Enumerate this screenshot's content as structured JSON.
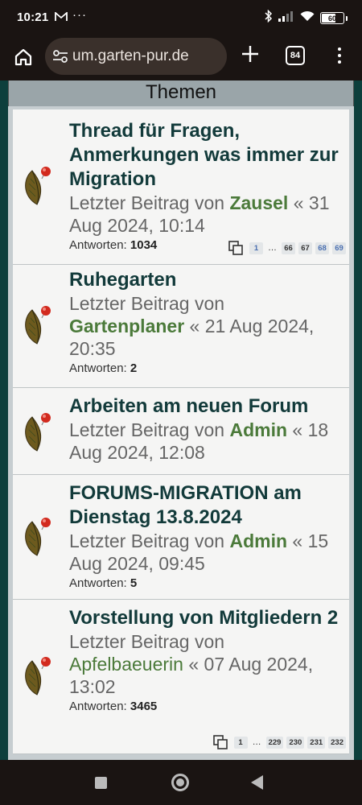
{
  "status_bar": {
    "time": "10:21",
    "dots": "···",
    "battery": "60",
    "icons": [
      "gmail-icon",
      "bluetooth-icon",
      "signal-icon",
      "wifi-icon",
      "battery-icon"
    ]
  },
  "browser": {
    "url": "um.garten-pur.de",
    "tab_count": "84",
    "icons": [
      "home-icon",
      "site-settings-icon",
      "new-tab-icon",
      "tabs-icon",
      "menu-icon"
    ]
  },
  "section_title": "Themen",
  "topics": [
    {
      "title": "Thread für Fragen, Anmerkungen was immer zur Migration",
      "last_prefix": "Letzter Beitrag von",
      "author": "Zausel",
      "date": "« 31 Aug 2024, 10:14",
      "replies_label": "Antworten:",
      "replies": "1034",
      "pages": [
        "1",
        "…",
        "66",
        "67",
        "68",
        "69"
      ]
    },
    {
      "title": "Ruhegarten",
      "last_prefix": "Letzter Beitrag von",
      "author": "Gartenplaner",
      "date": "« 21 Aug 2024, 20:35",
      "replies_label": "Antworten:",
      "replies": "2"
    },
    {
      "title": "Arbeiten am neuen Forum",
      "last_prefix": "Letzter Beitrag von",
      "author": "Admin",
      "date": "« 18 Aug 2024, 12:08"
    },
    {
      "title": "FORUMS-MIGRATION am Dienstag 13.8.2024",
      "last_prefix": "Letzter Beitrag von",
      "author": "Admin",
      "date": "« 15 Aug 2024, 09:45",
      "replies_label": "Antworten:",
      "replies": "5"
    },
    {
      "title": "Vorstellung von Mitgliedern 2",
      "last_prefix": "Letzter Beitrag von",
      "author": "Apfelbaeuerin",
      "date": "« 07 Aug 2024, 13:02",
      "replies_label": "Antworten:",
      "replies": "3465",
      "pages": [
        "1",
        "…",
        "229",
        "230",
        "231",
        "232"
      ]
    }
  ],
  "colors": {
    "author": "#4b7a3a",
    "title": "#123a3a",
    "frame": "#0d3f3c"
  }
}
